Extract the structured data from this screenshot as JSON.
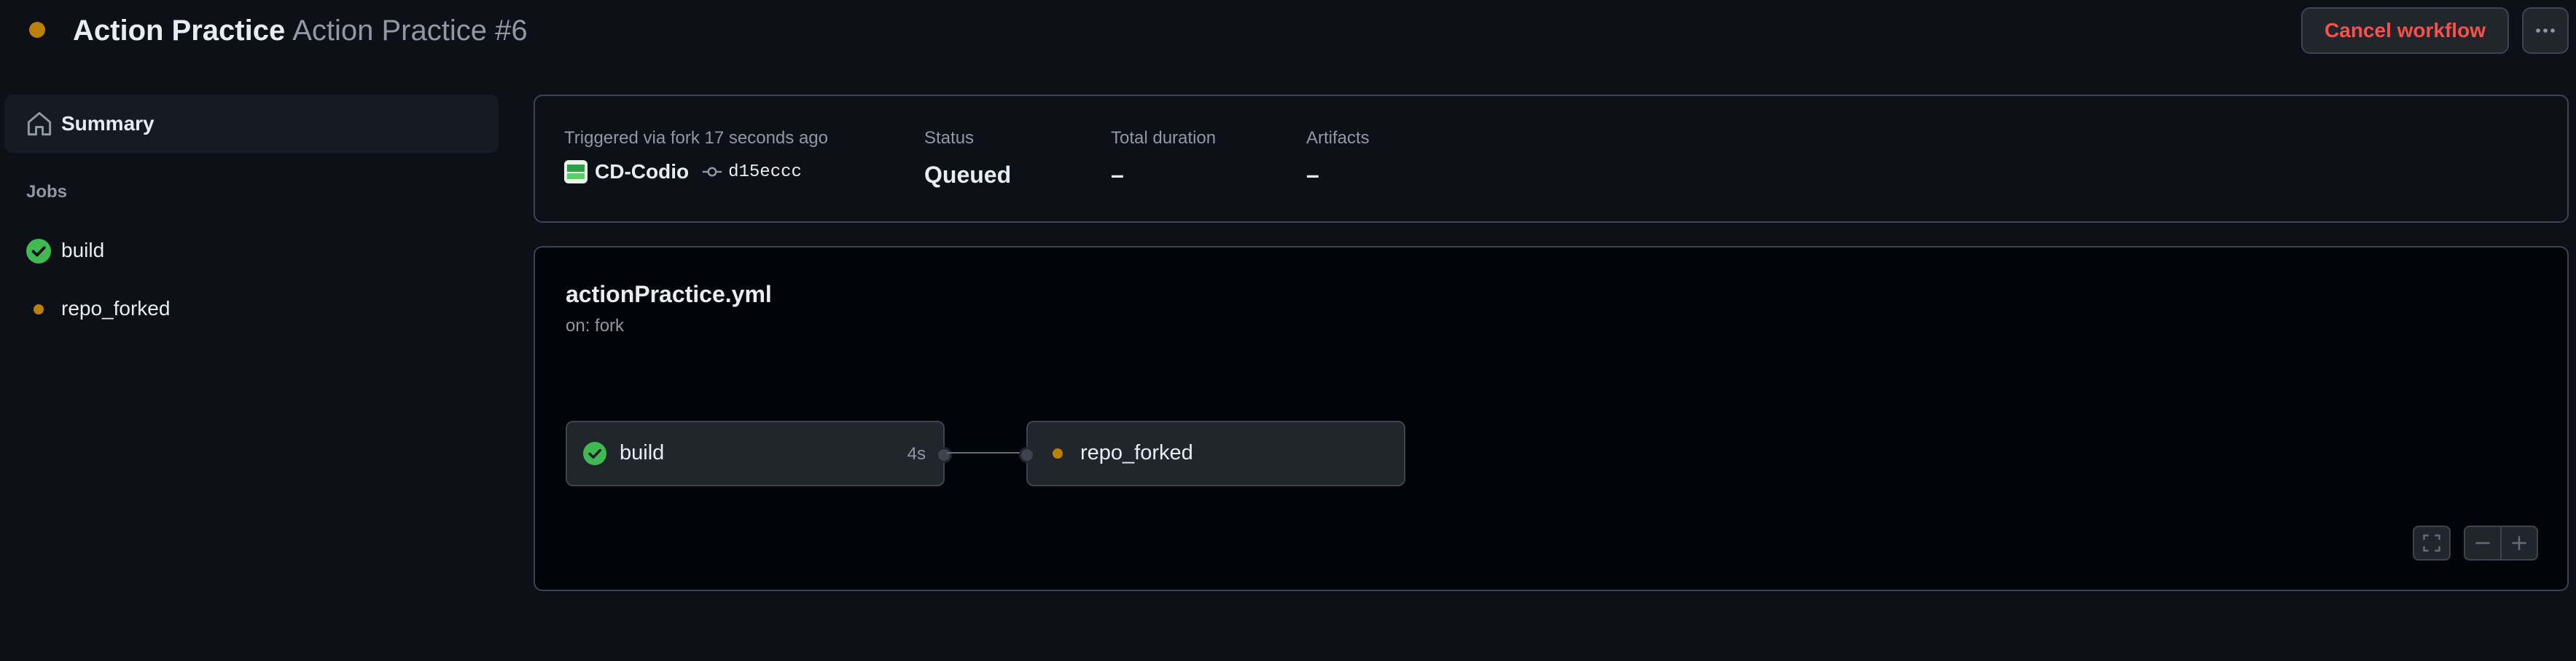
{
  "header": {
    "workflow_name": "Action Practice",
    "run_title": "Action Practice #6",
    "cancel_label": "Cancel workflow",
    "status_color": "#bb8009"
  },
  "sidebar": {
    "summary_label": "Summary",
    "jobs_heading": "Jobs",
    "jobs": [
      {
        "label": "build",
        "status": "success",
        "icon": "check-circle-icon"
      },
      {
        "label": "repo_forked",
        "status": "queued",
        "icon": "queued-dot-icon"
      }
    ]
  },
  "info": {
    "trigger_text": "Triggered via fork 17 seconds ago",
    "actor": "CD-Codio",
    "commit": "d15eccc",
    "status_label": "Status",
    "status_value": "Queued",
    "duration_label": "Total duration",
    "duration_value": "–",
    "artifacts_label": "Artifacts",
    "artifacts_value": "–"
  },
  "graph": {
    "file": "actionPractice.yml",
    "trigger": "on: fork",
    "nodes": [
      {
        "label": "build",
        "duration": "4s",
        "status": "success"
      },
      {
        "label": "repo_forked",
        "duration": "",
        "status": "queued"
      }
    ]
  },
  "colors": {
    "success": "#3fb950",
    "queued": "#bb8009",
    "danger": "#f85149",
    "background": "#0d1117"
  }
}
